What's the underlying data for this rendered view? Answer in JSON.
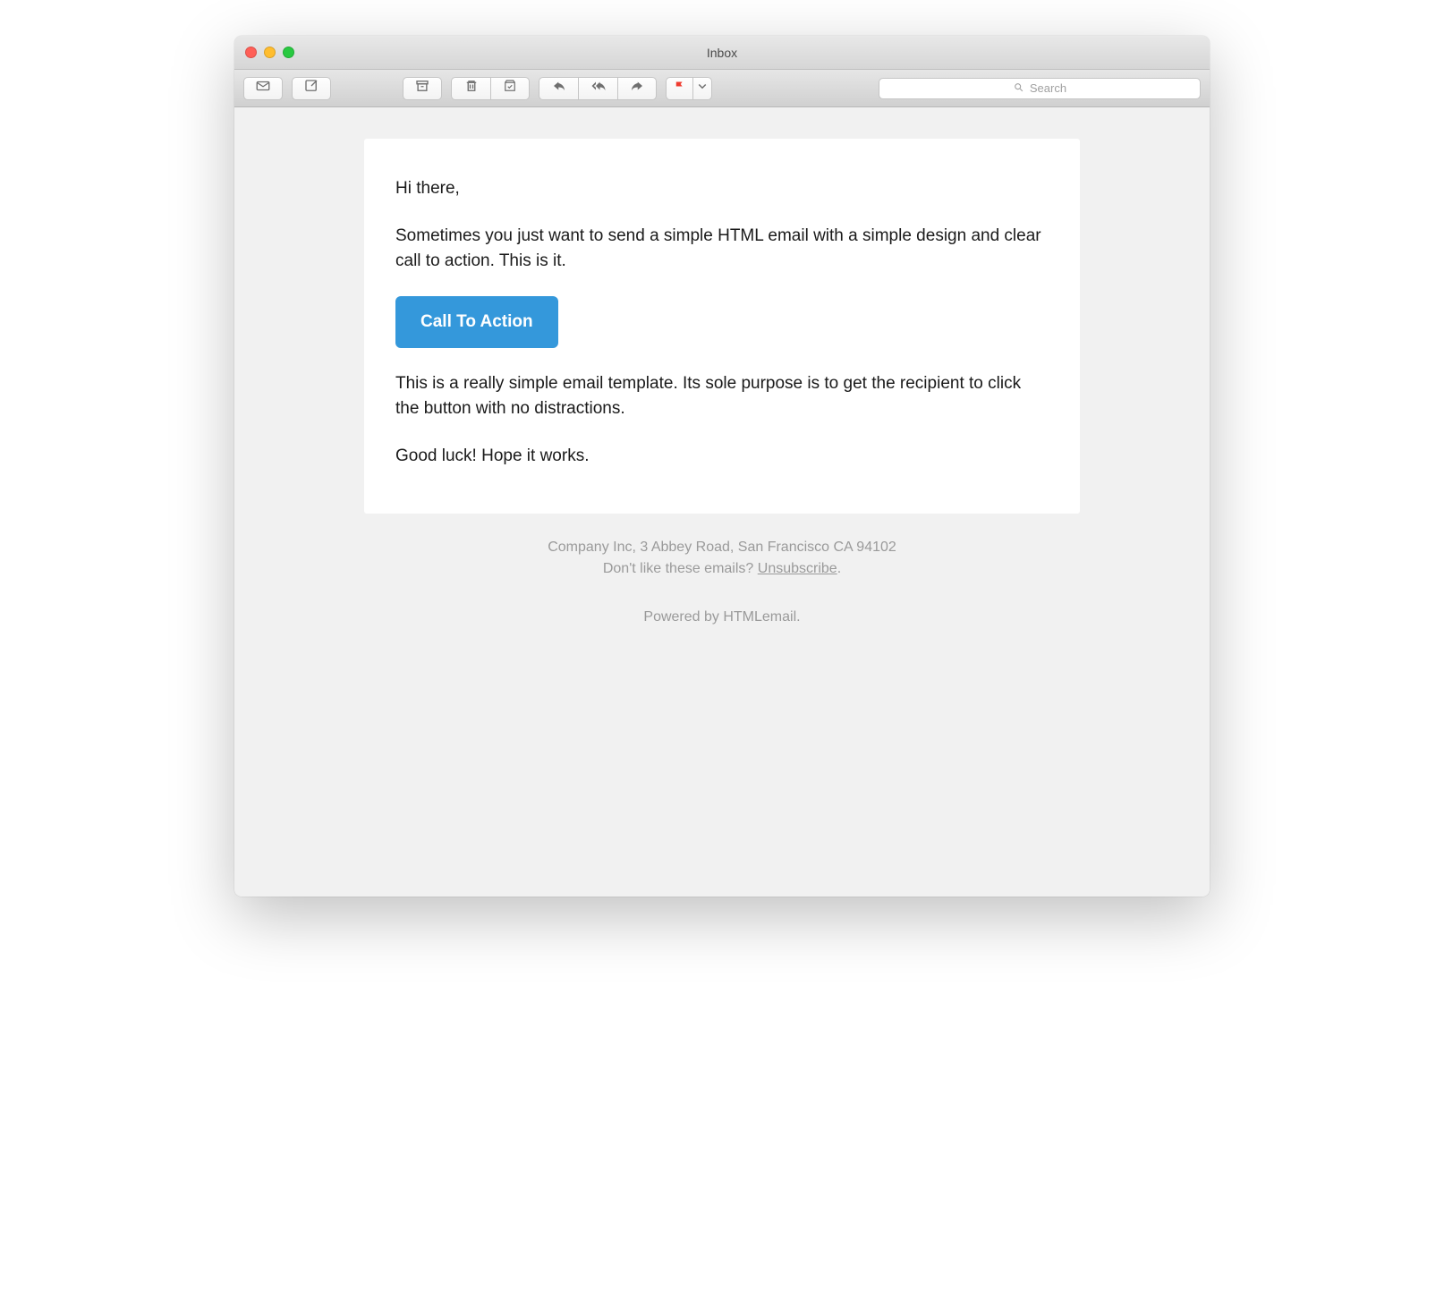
{
  "window": {
    "title": "Inbox"
  },
  "search": {
    "placeholder": "Search"
  },
  "email": {
    "greeting": "Hi there,",
    "intro": "Sometimes you just want to send a simple HTML email with a simple design and clear call to action. This is it.",
    "cta_label": "Call To Action",
    "body": "This is a really simple email template. Its sole purpose is to get the recipient to click the button with no distractions.",
    "closing": "Good luck! Hope it works."
  },
  "footer": {
    "address": "Company Inc, 3 Abbey Road, San Francisco CA 94102",
    "unsub_prefix": "Don't like these emails? ",
    "unsub_link": "Unsubscribe",
    "unsub_suffix": ".",
    "powered_prefix": "Powered by ",
    "powered_link": "HTMLemail",
    "powered_suffix": "."
  },
  "colors": {
    "accent": "#3498db",
    "flag": "#ef3b2f"
  }
}
